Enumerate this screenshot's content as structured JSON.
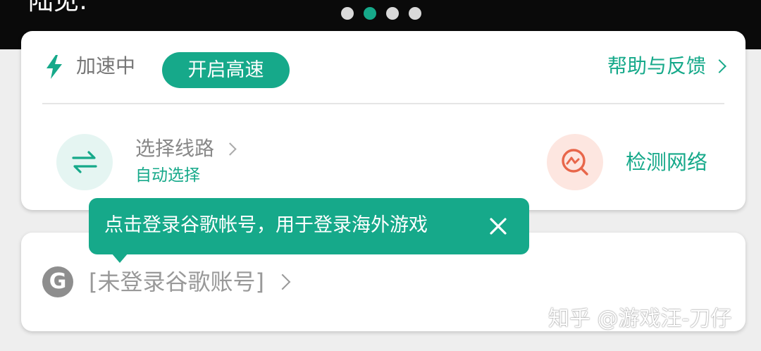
{
  "banner": {
    "text": "陆见:"
  },
  "carousel": {
    "dot_count": 4,
    "active_index": 1
  },
  "colors": {
    "accent": "#16a98a",
    "detect_bg": "#fde6e0",
    "detect_icon": "#e8664a",
    "route_bg": "#e5f5f2"
  },
  "status": {
    "text": "加速中",
    "speed_button": "开启高速",
    "help_label": "帮助与反馈"
  },
  "route": {
    "label": "选择线路",
    "value": "自动选择",
    "icon": "swap-arrows-icon"
  },
  "detect": {
    "label": "检测网络",
    "icon": "network-detect-icon"
  },
  "tooltip": {
    "text": "点击登录谷歌帐号，用于登录海外游戏"
  },
  "account": {
    "icon_letter": "G",
    "text": "[未登录谷歌账号]"
  },
  "watermark": {
    "text": "知乎 @游戏汪-刀仔"
  }
}
